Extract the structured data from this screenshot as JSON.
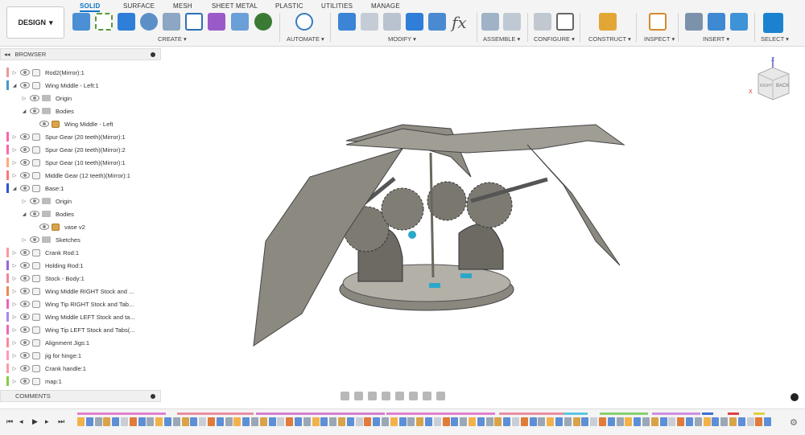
{
  "workspace": {
    "label": "DESIGN"
  },
  "tabs": [
    "SOLID",
    "SURFACE",
    "MESH",
    "SHEET METAL",
    "PLASTIC",
    "UTILITIES",
    "MANAGE"
  ],
  "toolbar_groups": [
    "CREATE ▾",
    "AUTOMATE ▾",
    "MODIFY ▾",
    "ASSEMBLE ▾",
    "CONFIGURE ▾",
    "CONSTRUCT ▾",
    "INSPECT ▾",
    "INSERT ▾",
    "SELECT ▾"
  ],
  "modify_fx": "fx",
  "browser": {
    "title": "BROWSER",
    "items": [
      {
        "label": "Rod2(Mirror):1"
      },
      {
        "label": "Wing Middle - Left:1"
      },
      {
        "label": "Origin"
      },
      {
        "label": "Bodies"
      },
      {
        "label": "Wing Middle - Left"
      },
      {
        "label": "Spur Gear (20 teeth)(Mirror):1"
      },
      {
        "label": "Spur Gear (20 teeth)(Mirror):2"
      },
      {
        "label": "Spur Gear (10 teeth)(Mirror):1"
      },
      {
        "label": "Middle Gear (12 teeth)(Mirror):1"
      },
      {
        "label": "Base:1"
      },
      {
        "label": "Origin"
      },
      {
        "label": "Bodies"
      },
      {
        "label": "vase v2"
      },
      {
        "label": "Sketches"
      },
      {
        "label": "Crank Rod:1"
      },
      {
        "label": "Holding Rod:1"
      },
      {
        "label": "Stock - Body:1"
      },
      {
        "label": "Wing Middle RIGHT Stock and ..."
      },
      {
        "label": "Wing Tip RIGHT Stock and Tab..."
      },
      {
        "label": "Wing Middle LEFT Stock and ta..."
      },
      {
        "label": "Wing Tip LEFT Stock and Tabs(..."
      },
      {
        "label": "Alignment Jigs:1"
      },
      {
        "label": "jig for hinge:1"
      },
      {
        "label": "Crank handle:1"
      },
      {
        "label": "map:1"
      }
    ]
  },
  "comments": {
    "title": "COMMENTS"
  },
  "viewcube": {
    "top": "Z",
    "right_face": "BACK",
    "left_face": "RIGHT",
    "x_axis": "X"
  },
  "colors": {
    "accent": "#0a73c7",
    "model": "#7d7a72"
  }
}
